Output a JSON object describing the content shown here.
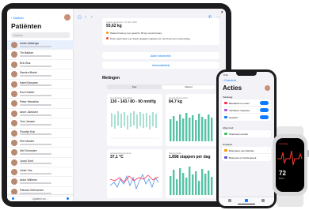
{
  "ipad": {
    "sidebar": {
      "back": "‹ Zoeken",
      "title": "Patiënten",
      "search_placeholder": "Zoeken",
      "footer": "Updated om ...",
      "patients": [
        {
          "name": "Ineke Aalberge"
        },
        {
          "name": "Tin Bakker"
        },
        {
          "name": "Eric Bos"
        },
        {
          "name": "Sandra Boele"
        },
        {
          "name": "Karel Brouwer"
        },
        {
          "name": "Eva Dekker"
        },
        {
          "name": "Peter Hendriks"
        },
        {
          "name": "Anne Janssen"
        },
        {
          "name": "Tom Jansen"
        },
        {
          "name": "Floortje Kok"
        },
        {
          "name": "Piet Mulder"
        },
        {
          "name": "Nel Schouten"
        },
        {
          "name": "Joost Smit"
        },
        {
          "name": "Lieke Vos"
        },
        {
          "name": "Anke Willems"
        },
        {
          "name": "Patricia Verhoeven"
        }
      ]
    },
    "top_card": {
      "small": "Laatst gewogen: 12 feb 2020",
      "big": "93,62 kg",
      "line1": "Waarschuwing voor gewicht: 89 kg overschreden",
      "line2": "8 liter gedronken per drank-uitgaapr ingeleerd en niet thuis een onspouwlag"
    },
    "btn1": "Aktie informeren",
    "btn2": "Informatieblok",
    "metingen_title": "Metingen",
    "segments": [
      "Dag",
      "Maand"
    ],
    "cards": [
      {
        "label": "Gemiddelde bloeddruk",
        "value": "130 - 143 / 80 - 90 mmHg"
      },
      {
        "label": "Gemiddeld gewicht",
        "value": "84,7 kg"
      },
      {
        "label": "Lichaamstemperatuur",
        "value": "37,1 °C"
      },
      {
        "label": "Stappenteller",
        "value": "1.898 stappen per dag"
      }
    ],
    "colors": {
      "accent": "#0a7aff",
      "bar": "#55c2a6",
      "line": "#4a90e2"
    }
  },
  "iphone": {
    "status": "9:41",
    "back": "‹ Overzicht",
    "title": "Acties",
    "sections": [
      {
        "title": "Vandaag",
        "rows": [
          "Bloeddruk te meten",
          "Vertrikken inspotten",
          "Gewicht"
        ]
      },
      {
        "title": "Afgerond",
        "rows": [
          "Telefonish contact"
        ]
      },
      {
        "title": "Gepland",
        "rows": [
          "Bespreken van klachten",
          "Bespreek en herbespreek"
        ]
      }
    ],
    "row_icon_colors": [
      "#ff2d55",
      "#af52de",
      "#0a7aff",
      "#34c759",
      "#ff9500",
      "#5856d6"
    ]
  },
  "watch": {
    "heading": "Hartslag",
    "bpm": "72",
    "unit": "BPM",
    "color": "#ff3b30"
  }
}
